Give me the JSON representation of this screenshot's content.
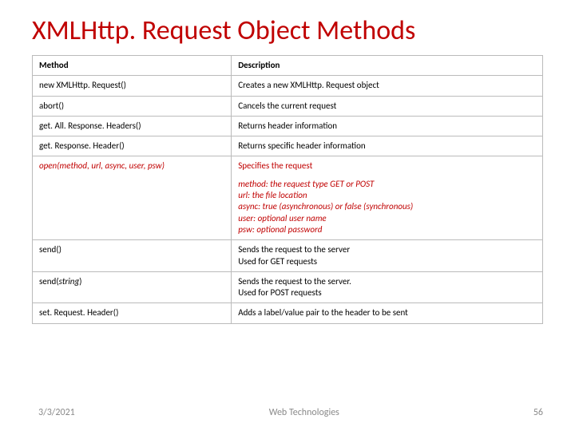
{
  "title": "XMLHttp. Request Object Methods",
  "headers": {
    "method": "Method",
    "description": "Description"
  },
  "rows": {
    "new": {
      "m": "new XMLHttp. Request()",
      "d": "Creates a new XMLHttp. Request object"
    },
    "abort": {
      "m": "abort()",
      "d": "Cancels the current request"
    },
    "getAll": {
      "m": "get. All. Response. Headers()",
      "d": "Returns header information"
    },
    "getOne": {
      "m": "get. Response. Header()",
      "d": "Returns specific header information"
    },
    "open": {
      "m": "open(method, url, async, user, psw)",
      "spec": "Specifies the request",
      "details": {
        "method": "method: the request type GET or POST",
        "url": "url: the file location",
        "async": "async: true (asynchronous) or false (synchronous)",
        "user": "user: optional user name",
        "psw": "psw: optional password"
      }
    },
    "send": {
      "m": "send()",
      "d1": "Sends the request to the server",
      "d2": "Used for GET requests"
    },
    "sendStr": {
      "m": "send(string)",
      "d1": "Sends the request to the server.",
      "d2": "Used for POST requests"
    },
    "setHdr": {
      "m": "set. Request. Header()",
      "d": "Adds a label/value pair to the header to be sent"
    }
  },
  "footer": {
    "date": "3/3/2021",
    "mid": "Web Technologies",
    "page": "56"
  }
}
